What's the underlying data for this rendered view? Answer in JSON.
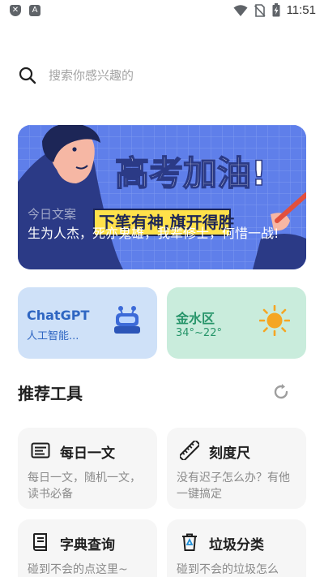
{
  "status_bar": {
    "time": "11:51",
    "left_icons": [
      "shield-x-icon",
      "font-icon"
    ],
    "right_icons": [
      "wifi-icon",
      "no-sim-icon",
      "battery-charging-icon"
    ]
  },
  "search": {
    "placeholder": "搜索你感兴趣的",
    "icon": "search-icon"
  },
  "banner": {
    "headline": "高考加油!",
    "subline": "下笔有神,旗开得胜",
    "label": "今日文案",
    "quote": "生为人杰，死亦鬼雄，我辈修士，何惜一战!"
  },
  "cards": {
    "chat": {
      "title": "ChatGPT",
      "subtitle": "人工智能...",
      "icon": "robot-icon"
    },
    "weather": {
      "title": "金水区",
      "temperature": "34°~22°",
      "icon": "sun-icon"
    }
  },
  "section": {
    "title": "推荐工具",
    "refresh_icon": "refresh-icon"
  },
  "tools": [
    {
      "title": "每日一文",
      "desc": "每日一文，随机一文，读书必备",
      "icon": "article-icon"
    },
    {
      "title": "刻度尺",
      "desc": "没有迟子怎么办？有他一键搞定",
      "icon": "ruler-icon"
    },
    {
      "title": "字典查询",
      "desc": "碰到不会的点这里~",
      "icon": "dictionary-icon"
    },
    {
      "title": "垃圾分类",
      "desc": "碰到不会的垃圾怎么",
      "icon": "recycle-bin-icon"
    }
  ],
  "colors": {
    "accent_blue": "#2f66c2",
    "accent_green": "#27956a",
    "banner_bg": "#5f7fea"
  }
}
